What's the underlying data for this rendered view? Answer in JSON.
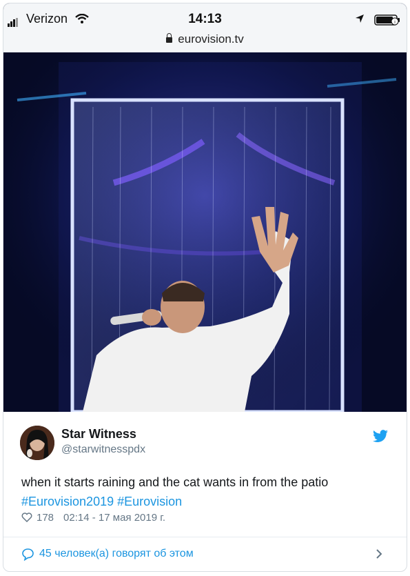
{
  "status_bar": {
    "carrier": "Verizon",
    "time": "14:13",
    "url": "eurovision.tv"
  },
  "tweet": {
    "display_name": "Star Witness",
    "handle": "@starwitnesspdx",
    "text": "when it starts raining and the cat wants in from the patio",
    "hashtags": [
      "#Eurovision2019",
      "#Eurovision"
    ],
    "likes": "178",
    "timestamp": "02:14 - 17 мая 2019 г.",
    "discussion": "45 человек(а) говорят об этом"
  },
  "icons": [
    "signal-icon",
    "wifi-icon",
    "lock-icon",
    "location-icon",
    "battery-icon",
    "twitter-bird-icon",
    "heart-icon",
    "comment-icon",
    "chevron-right-icon"
  ],
  "colors": {
    "link": "#1b95e0",
    "muted": "#657786",
    "text": "#14171a"
  }
}
